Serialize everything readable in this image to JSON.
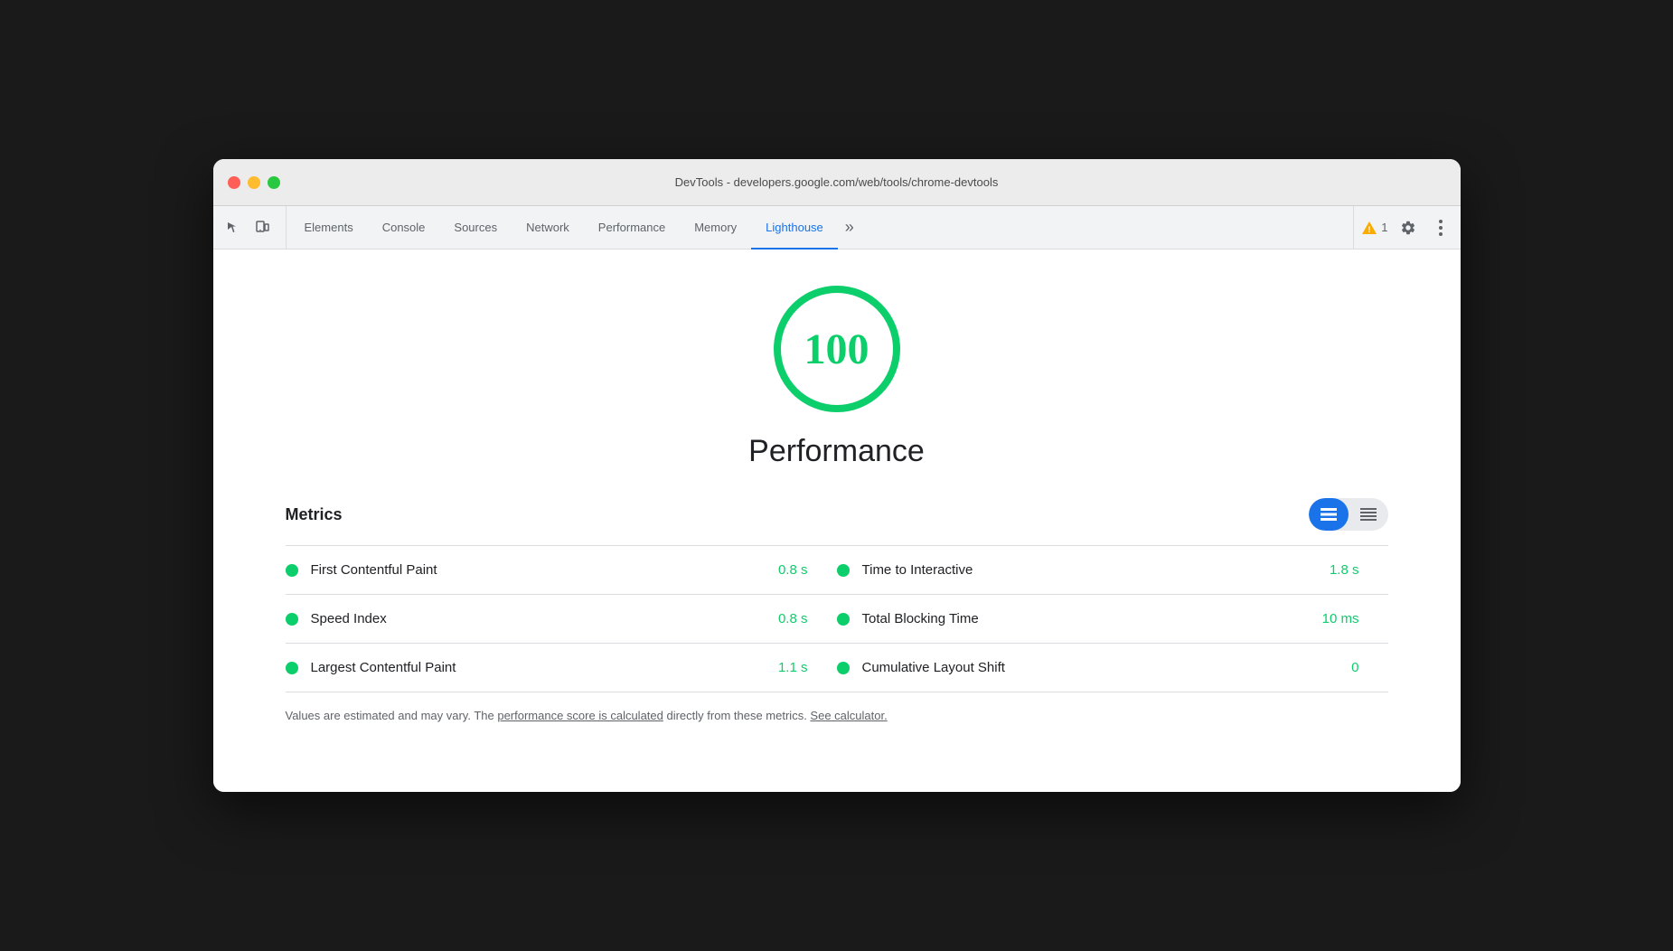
{
  "window": {
    "title": "DevTools - developers.google.com/web/tools/chrome-devtools"
  },
  "toolbar": {
    "tabs": [
      {
        "id": "elements",
        "label": "Elements",
        "active": false
      },
      {
        "id": "console",
        "label": "Console",
        "active": false
      },
      {
        "id": "sources",
        "label": "Sources",
        "active": false
      },
      {
        "id": "network",
        "label": "Network",
        "active": false
      },
      {
        "id": "performance",
        "label": "Performance",
        "active": false
      },
      {
        "id": "memory",
        "label": "Memory",
        "active": false
      },
      {
        "id": "lighthouse",
        "label": "Lighthouse",
        "active": true
      }
    ],
    "warning_count": "1",
    "more_tabs_label": "»"
  },
  "score": {
    "value": "100",
    "label": "Performance"
  },
  "metrics": {
    "title": "Metrics",
    "rows": [
      {
        "left_name": "First Contentful Paint",
        "left_value": "0.8 s",
        "right_name": "Time to Interactive",
        "right_value": "1.8 s"
      },
      {
        "left_name": "Speed Index",
        "left_value": "0.8 s",
        "right_name": "Total Blocking Time",
        "right_value": "10 ms"
      },
      {
        "left_name": "Largest Contentful Paint",
        "left_value": "1.1 s",
        "right_name": "Cumulative Layout Shift",
        "right_value": "0"
      }
    ],
    "note_prefix": "Values are estimated and may vary. The ",
    "note_link1": "performance score is calculated",
    "note_middle": " directly from these metrics. ",
    "note_link2": "See calculator.",
    "note_suffix": ""
  },
  "icons": {
    "inspect": "⬚",
    "device": "⬜",
    "more": "⋮",
    "gear": "⚙",
    "grid_view": "≡",
    "list_view": "≡"
  }
}
